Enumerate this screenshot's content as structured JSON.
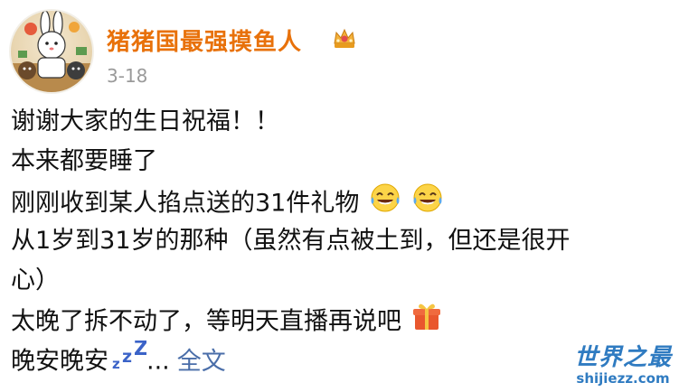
{
  "post": {
    "author": "猪猪国最强摸鱼人",
    "date": "3-18",
    "lines": [
      "谢谢大家的生日祝福！！",
      "本来都要睡了",
      "刚刚收到某人掐点送的31件礼物",
      "从1岁到31岁的那种（虽然有点被土到，但还是很开",
      "心）",
      "太晚了拆不动了，等明天直播再说吧",
      "晚安晚安"
    ],
    "ellipsis": "...",
    "read_more": "全文",
    "icons": {
      "badge": "crown-badge-icon",
      "laugh": "tears-of-joy-emoji",
      "gift": "gift-emoji",
      "sleep": "zzz-emoji"
    }
  },
  "watermark": {
    "logo": "世界之最",
    "url": "shijiezz.com"
  },
  "colors": {
    "author": "#e8710a",
    "link": "#4a6ea9",
    "watermark": "#2f7bc1"
  }
}
